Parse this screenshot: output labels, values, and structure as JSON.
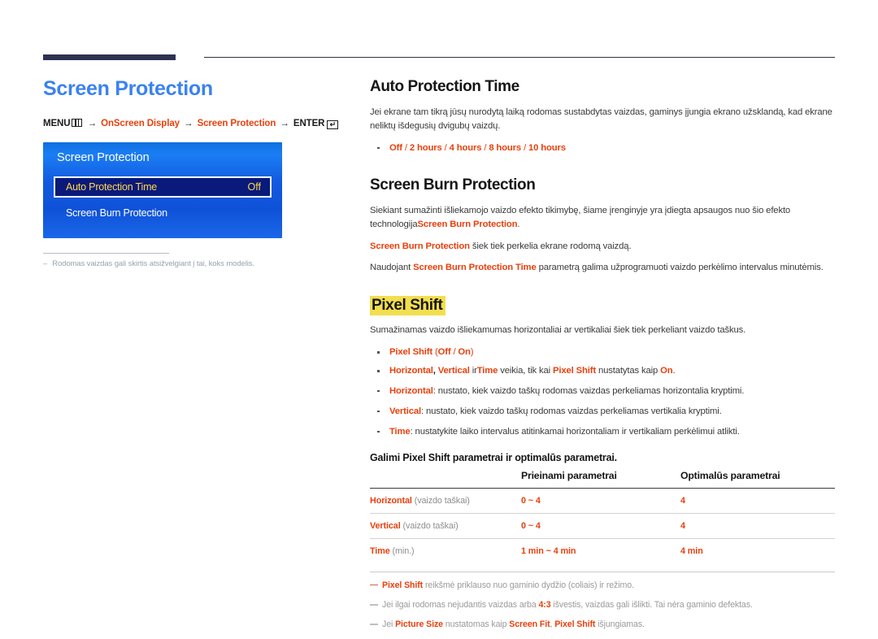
{
  "header": {
    "bar_color": "#2e3152",
    "rule_color": "#2e3152"
  },
  "left": {
    "chapter_title": "Screen Protection",
    "breadcrumb": {
      "menu_label": "MENU",
      "menu_icon": "menu-bars-icon",
      "arrow": "→",
      "step1": "OnScreen Display",
      "step2": "Screen Protection",
      "enter_label": "ENTER",
      "enter_icon": "enter-key-icon",
      "enter_glyph": "↵"
    },
    "osd": {
      "title": "Screen Protection",
      "rows": [
        {
          "label": "Auto Protection Time",
          "value": "Off",
          "selected": true
        },
        {
          "label": "Screen Burn Protection",
          "value": "",
          "selected": false
        }
      ],
      "gradient_top": "#1b7ef4",
      "gradient_bottom": "#0e52d8",
      "selected_bg": "#0a1a7a",
      "value_color": "#ffd84d"
    },
    "note": {
      "dash": "–",
      "text": "Rodomas vaizdas gali skirtis atsižvelgiant į tai, koks modelis."
    }
  },
  "right": {
    "accent_color": "#e8400d",
    "highlight_color": "#f2de4e",
    "auto_protection": {
      "heading": "Auto Protection Time",
      "body": "Jei ekrane tam tikrą jūsų nurodytą laiką rodomas sustabdytas vaizdas, gaminys įjungia ekrano užsklandą, kad ekrane neliktų išdegusių dvigubų vaizdų.",
      "options": {
        "opt1": "Off",
        "sep1": " / ",
        "opt2": "2 hours",
        "sep2": " / ",
        "opt3": "4 hours",
        "sep3": " / ",
        "opt4": "8 hours",
        "sep4": " / ",
        "opt5": "10 hours"
      }
    },
    "burn_protection": {
      "heading": "Screen Burn Protection",
      "p1_a": "Siekiant sumažinti išliekamojo vaizdo efekto tikimybę, šiame įrenginyje yra įdiegta apsaugos nuo šio efekto technologija",
      "p1_b": "Screen Burn Protection",
      "p1_c": ".",
      "p2_a": "Screen Burn Protection",
      "p2_b": " šiek tiek perkelia ekrane rodomą vaizdą.",
      "p3_a": "Naudojant ",
      "p3_b": "Screen Burn Protection Time",
      "p3_c": " parametrą galima užprogramuoti vaizdo perkėlimo intervalus minutėmis."
    },
    "pixel_shift": {
      "heading": "Pixel Shift",
      "body": "Sumažinamas vaizdo išliekamumas horizontaliai ar vertikaliai šiek tiek perkeliant vaizdo taškus.",
      "bullet1": {
        "name": "Pixel Shift",
        "paren_open": " (",
        "opt1": "Off",
        "sep": " / ",
        "opt2": "On",
        "paren_close": ")"
      },
      "subnote": {
        "t1": "Horizontal",
        "t2": ", ",
        "t3": "Vertical",
        "t4": " ir",
        "t5": "Time",
        "t6": " veikia, tik kai ",
        "t7": "Pixel Shift",
        "t8": " nustatytas kaip ",
        "t9": "On",
        "t10": "."
      },
      "bullet2": {
        "name": "Horizontal",
        "text": ": nustato, kiek vaizdo taškų rodomas vaizdas perkeliamas horizontalia kryptimi."
      },
      "bullet3": {
        "name": "Vertical",
        "text": ": nustato, kiek vaizdo taškų rodomas vaizdas perkeliamas vertikalia kryptimi."
      },
      "bullet4": {
        "name": "Time",
        "text": ": nustatykite laiko intervalus atitinkamai horizontaliam ir vertikaliam perkėlimui atlikti."
      }
    },
    "table": {
      "caption": "Galimi Pixel Shift parametrai ir optimalūs parametrai.",
      "headers": [
        "",
        "Prieinami parametrai",
        "Optimalūs parametrai"
      ],
      "rows": [
        {
          "label": "Horizontal",
          "unit": " (vaizdo taškai)",
          "available": "0 ~ 4",
          "optimal": "4"
        },
        {
          "label": "Vertical",
          "unit": " (vaizdo taškai)",
          "available": "0 ~ 4",
          "optimal": "4"
        },
        {
          "label": "Time",
          "unit": " (min.)",
          "available": "1 min ~ 4 min",
          "optimal": "4 min"
        }
      ]
    },
    "notes": {
      "n1_a": "Pixel Shift",
      "n1_b": " reikšmė priklauso nuo gaminio dydžio (coliais) ir režimo.",
      "n2_a": "Jei ilgai rodomas nejudantis vaizdas arba ",
      "n2_b": "4:3",
      "n2_c": " išvestis, vaizdas gali išlikti. Tai nėra gaminio defektas.",
      "n3_a": "Jei ",
      "n3_b": "Picture Size",
      "n3_c": " nustatomas kaip ",
      "n3_d": "Screen Fit",
      "n3_e": ", ",
      "n3_f": "Pixel Shift",
      "n3_g": " išjungiamas."
    }
  }
}
